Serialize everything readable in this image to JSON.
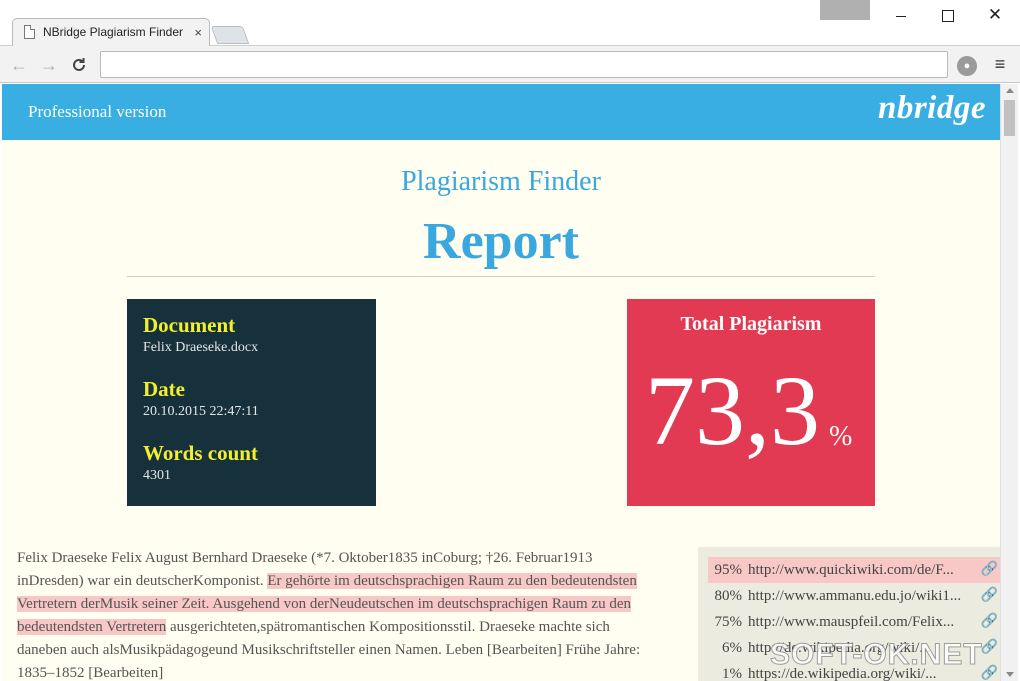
{
  "browser": {
    "tab_title": "NBridge Plagiarism Finder",
    "tab_close": "×",
    "url": "",
    "translate_icon": "文A",
    "star_icon": "☆",
    "menu_icon": "≡",
    "back_icon": "←",
    "forward_icon": "→",
    "reload_icon": "C",
    "close_icon": "✕"
  },
  "header": {
    "version": "Professional version",
    "logo": "nbridge"
  },
  "report": {
    "subtitle": "Plagiarism Finder",
    "title": "Report"
  },
  "info": {
    "document_label": "Document",
    "document_value": "Felix Draeseke.docx",
    "date_label": "Date",
    "date_value": "20.10.2015 22:47:11",
    "words_label": "Words count",
    "words_value": "4301"
  },
  "plagiarism": {
    "label": "Total Plagiarism",
    "value": "73,3",
    "unit": "%"
  },
  "text": {
    "segments": [
      {
        "text": "Felix Draeseke Felix August Bernhard Draeseke (*7. Oktober1835 inCoburg; †26. Februar1913 inDresden) war ein deutscherKomponist. ",
        "highlight": false
      },
      {
        "text": "Er gehörte im deutschsprachigen Raum zu den bedeutendsten Vertretern derMusik seiner Zeit. Ausgehend von derNeudeutschen im deutschsprachigen Raum zu den bedeutendsten Vertretern",
        "highlight": true
      },
      {
        "text": " ausgerichteten,spätromantischen Kompositionsstil. Draeseke machte sich daneben auch alsMusikpädagogeund Musikschriftsteller einen Namen. Leben [Bearbeiten] Frühe Jahre: 1835–1852 [Bearbeiten]",
        "highlight": false
      }
    ]
  },
  "sources": [
    {
      "pct": "95%",
      "url": "http://www.quickiwiki.com/de/F...",
      "top": true
    },
    {
      "pct": "80%",
      "url": "http://www.ammanu.edu.jo/wiki1...",
      "top": false
    },
    {
      "pct": "75%",
      "url": "http://www.mauspfeil.com/Felix...",
      "top": false
    },
    {
      "pct": "6%",
      "url": "http://de.wikipedia.org/wiki/...",
      "top": false
    },
    {
      "pct": "1%",
      "url": "https://de.wikipedia.org/wiki/...",
      "top": false
    }
  ],
  "watermark": "SOFT-OK.NET"
}
